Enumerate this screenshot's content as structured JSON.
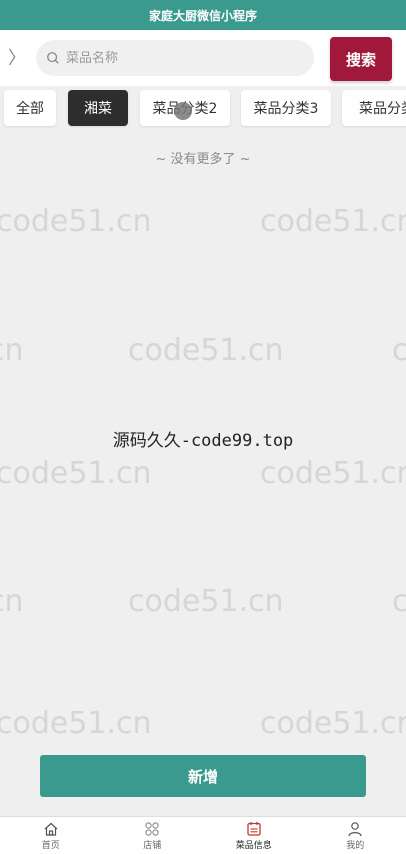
{
  "title": "家庭大厨微信小程序",
  "search": {
    "placeholder": "菜品名称",
    "button_label": "搜索"
  },
  "category_tabs": [
    {
      "label": "全部",
      "active": false
    },
    {
      "label": "湘菜",
      "active": true
    },
    {
      "label": "菜品分类2",
      "active": false
    },
    {
      "label": "菜品分类3",
      "active": false
    },
    {
      "label": "菜品分类",
      "active": false
    }
  ],
  "list_status": "~ 没有更多了 ~",
  "watermark_text": "code51.cn",
  "center_watermark": "源码久久-code99.top",
  "add_button_label": "新增",
  "bottom_nav": [
    {
      "label": "首页",
      "icon": "home-icon",
      "active": false
    },
    {
      "label": "店铺",
      "icon": "grid-icon",
      "active": false
    },
    {
      "label": "菜品信息",
      "icon": "menu-list-icon",
      "active": true
    },
    {
      "label": "我的",
      "icon": "user-icon",
      "active": false
    }
  ],
  "colors": {
    "primary": "#3a9a8e",
    "search_button": "#a0183a",
    "active_tab": "#2d2d2d",
    "active_nav_icon": "#c0392b"
  }
}
